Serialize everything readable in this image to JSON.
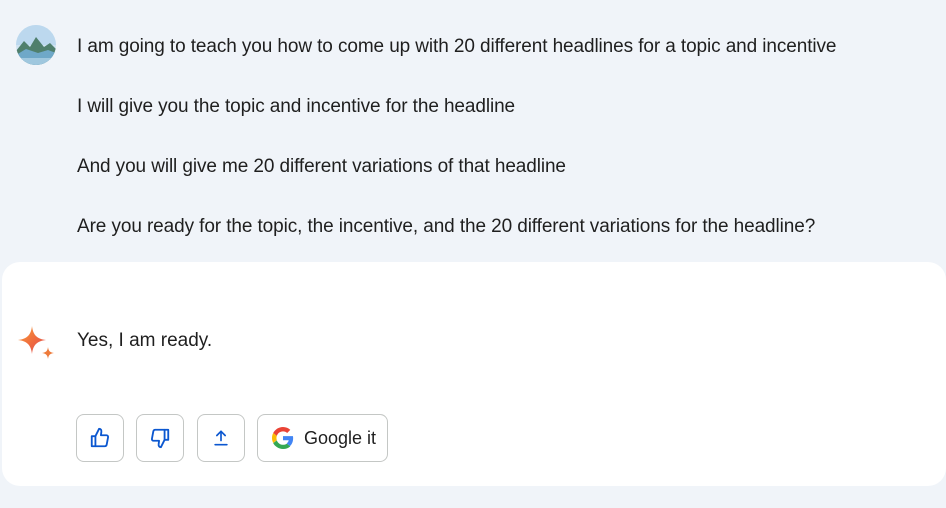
{
  "user_message": {
    "lines": [
      "I am going to teach you how to come up with 20 different headlines for a topic and incentive",
      "I will give you the topic and incentive for the headline",
      "And you will give me 20 different variations of that headline",
      "Are you ready for the topic, the incentive, and the 20 different variations for the headline?"
    ]
  },
  "response": {
    "text": "Yes, I am ready."
  },
  "actions": {
    "google_it_label": "Google it"
  },
  "colors": {
    "page_bg": "#f0f4f9",
    "card_bg": "#ffffff",
    "icon_blue": "#0b57d0",
    "border": "#c4c7c5"
  },
  "icons": [
    "user-avatar",
    "gemini-sparkle-icon",
    "thumbs-up-icon",
    "thumbs-down-icon",
    "share-icon",
    "google-g-icon"
  ]
}
